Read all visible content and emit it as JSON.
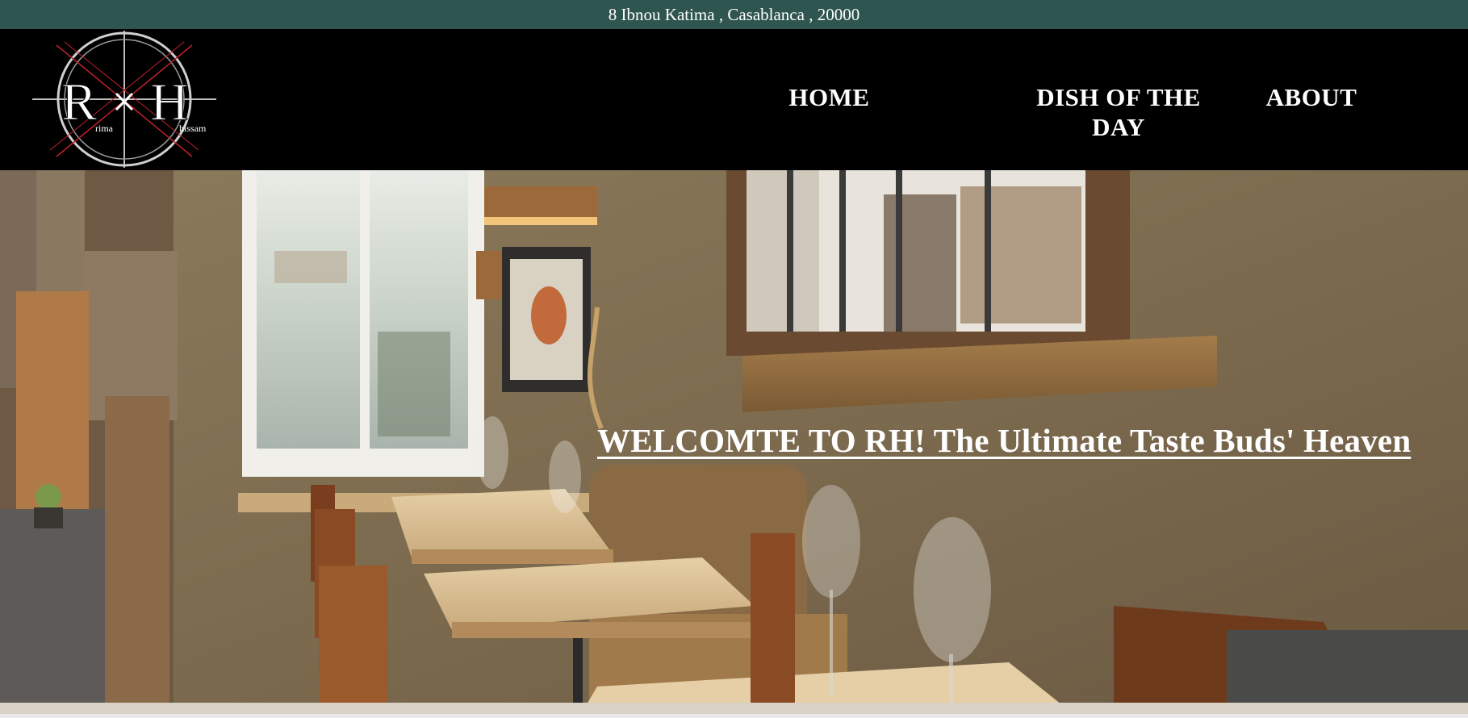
{
  "topbar": {
    "address": "8 Ibnou Katima , Casablanca , 20000"
  },
  "logo": {
    "monogram_left": "R",
    "monogram_right": "H",
    "name_left": "rima",
    "name_right": "hissam",
    "icon": "fork-and-knife-icon"
  },
  "nav": {
    "items": [
      {
        "label": "HOME"
      },
      {
        "label": "DISH OF THE DAY"
      },
      {
        "label": "ABOUT"
      }
    ]
  },
  "hero": {
    "title": "WELCOMTE TO RH! The Ultimate Taste Buds' Heaven"
  },
  "colors": {
    "topbar": "#2e5550",
    "navbar": "#000000",
    "text": "#ffffff",
    "logo_accent": "#c0202a"
  }
}
